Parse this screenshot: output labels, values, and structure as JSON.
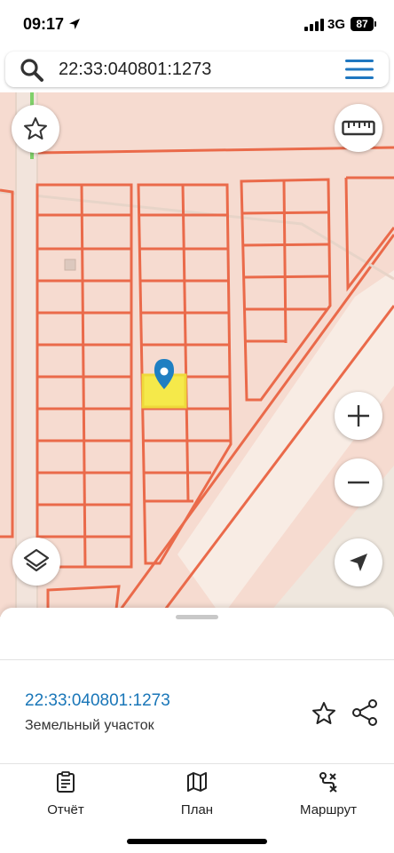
{
  "status_bar": {
    "time": "09:17",
    "network": "3G",
    "battery": "87",
    "icons": [
      "location-arrow-icon",
      "signal-bars-icon",
      "battery-icon"
    ]
  },
  "search": {
    "value": "22:33:040801:1273",
    "placeholder": "",
    "icons": [
      "search-icon",
      "hamburger-menu-icon"
    ]
  },
  "map": {
    "controls": [
      "favorite-star-icon",
      "ruler-icon",
      "zoom-in-icon",
      "zoom-out-icon",
      "layers-icon",
      "my-location-icon"
    ],
    "marker": "map-pin-icon",
    "colors": {
      "background": "#f6dbd0",
      "parcel_border": "#ea6a4a",
      "selected_parcel": "#f5e94a",
      "marker": "#1f7fc2"
    }
  },
  "card": {
    "cadastral_number": "22:33:040801:1273",
    "object_type": "Земельный участок",
    "icons": [
      "star-outline-icon",
      "share-icon"
    ]
  },
  "tabs": [
    {
      "label": "Отчёт",
      "icon": "report-icon"
    },
    {
      "label": "План",
      "icon": "map-plan-icon"
    },
    {
      "label": "Маршрут",
      "icon": "route-icon"
    }
  ],
  "colors": {
    "accent": "#1976b8",
    "menu": "#1f77c0"
  }
}
